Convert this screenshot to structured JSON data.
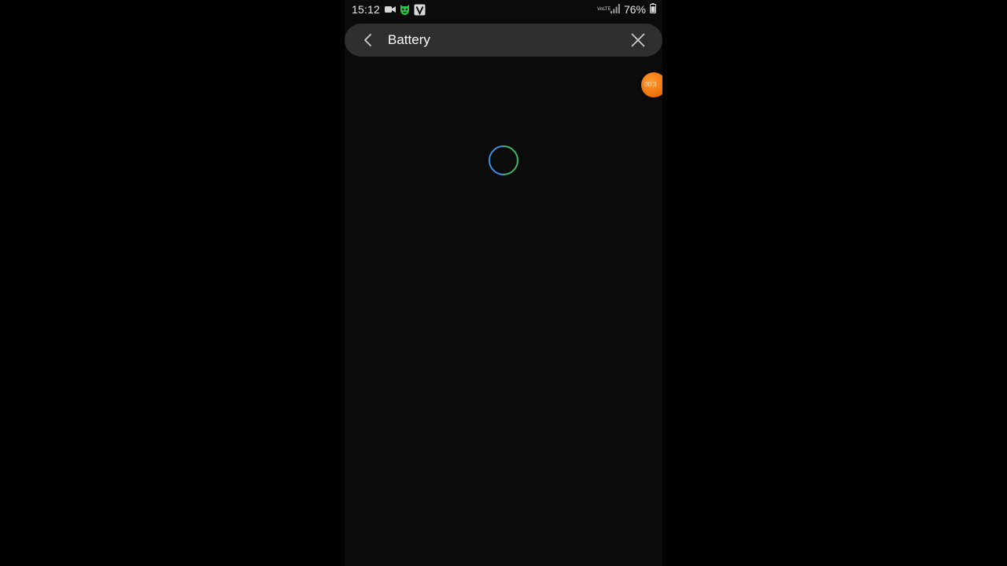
{
  "status_bar": {
    "time": "15:12",
    "volte_text": "VoLTE",
    "battery_percent": "76%",
    "icons": [
      "video-camera-icon",
      "shield-face-icon",
      "vpn-v-icon",
      "volte-icon",
      "signal-icon",
      "battery-icon"
    ]
  },
  "search": {
    "value": "Battery",
    "back_icon": "chevron-left-icon",
    "clear_icon": "close-icon"
  },
  "content": {
    "state": "loading",
    "spinner_colors": [
      "#3b8fe0",
      "#3ab86c"
    ]
  },
  "recorder": {
    "label": "00:3",
    "color": "#f0750e"
  }
}
